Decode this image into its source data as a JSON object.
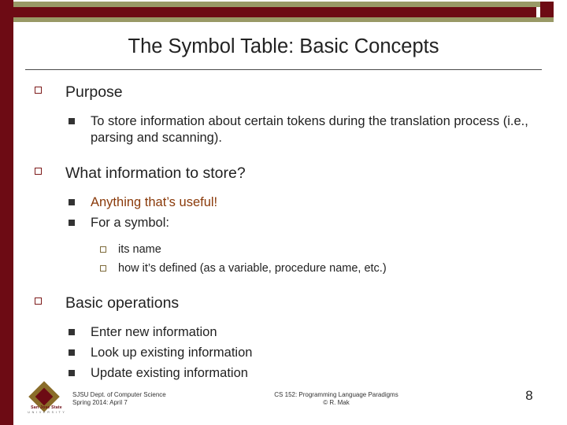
{
  "slide": {
    "title": "The Symbol Table: Basic Concepts",
    "page_number": "8",
    "accent_color": "#6d0b14",
    "olive_color": "#999966",
    "highlight_color": "#8a3a0a",
    "sections": [
      {
        "heading": "Purpose",
        "items": [
          {
            "text": "To store information about certain tokens during the translation process (i.e., parsing and scanning).",
            "highlight": false,
            "subitems": []
          }
        ]
      },
      {
        "heading": "What information to store?",
        "items": [
          {
            "text": "Anything that’s useful!",
            "highlight": true,
            "subitems": []
          },
          {
            "text": "For a symbol:",
            "highlight": false,
            "subitems": [
              "its name",
              "how it’s defined (as a variable, procedure name, etc.)"
            ]
          }
        ]
      },
      {
        "heading": "Basic operations",
        "items": [
          {
            "text": "Enter new information",
            "highlight": false,
            "subitems": []
          },
          {
            "text": "Look up existing information",
            "highlight": false,
            "subitems": []
          },
          {
            "text": "Update existing information",
            "highlight": false,
            "subitems": []
          }
        ]
      }
    ]
  },
  "footer": {
    "logo_name": "San Jose State",
    "logo_sub": "U N I V E R S I T Y",
    "left_line1": "SJSU Dept. of Computer Science",
    "left_line2": "Spring 2014: April 7",
    "center_line1": "CS 152: Programming Language Paradigms",
    "center_line2": "© R. Mak"
  }
}
